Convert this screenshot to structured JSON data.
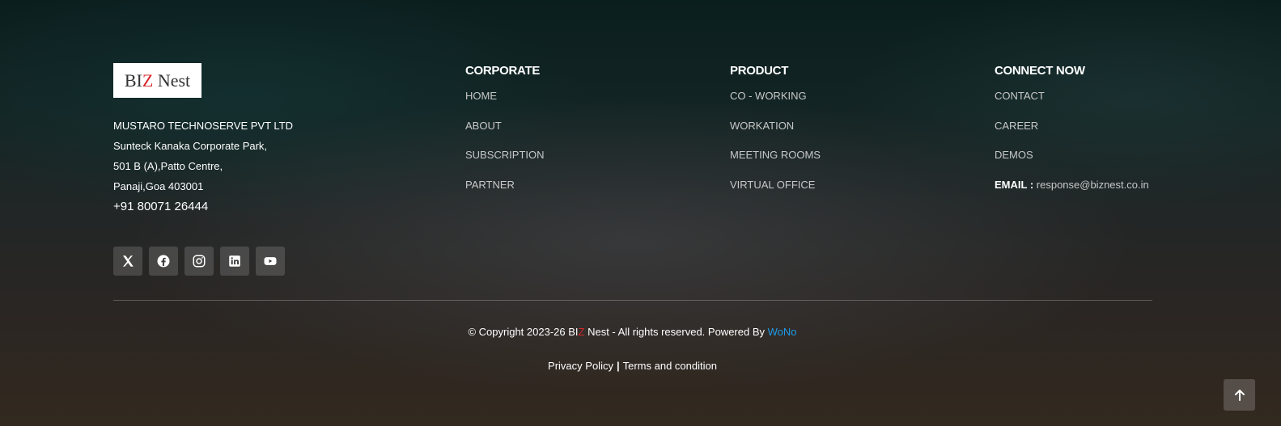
{
  "brand": {
    "logo": {
      "text_before": "BI",
      "text_z": "Z",
      "text_after": " Nest"
    },
    "company": "MUSTARO TECHNOSERVE PVT LTD",
    "address_line1": "Sunteck Kanaka Corporate Park,",
    "address_line2": "501 B (A),Patto Centre,",
    "address_line3": "Panaji,Goa 403001",
    "phone": "+91 80071 26444"
  },
  "social": [
    {
      "name": "x-icon"
    },
    {
      "name": "facebook-icon"
    },
    {
      "name": "instagram-icon"
    },
    {
      "name": "linkedin-icon"
    },
    {
      "name": "youtube-icon"
    }
  ],
  "columns": {
    "corporate": {
      "title": "CORPORATE",
      "links": [
        "HOME",
        "ABOUT",
        "SUBSCRIPTION",
        "PARTNER"
      ]
    },
    "product": {
      "title": "PRODUCT",
      "links": [
        "CO - WORKING",
        "WORKATION",
        "MEETING ROOMS",
        "VIRTUAL OFFICE"
      ]
    },
    "connect": {
      "title": "CONNECT NOW",
      "links": [
        "CONTACT",
        "CAREER",
        "DEMOS"
      ],
      "email_label": "EMAIL :",
      "email": "response@biznest.co.in"
    }
  },
  "copyright": {
    "prefix": "© Copyright 2023-26 BI",
    "z": "Z",
    "suffix": " Nest - All rights reserved. Powered By ",
    "powered_by": "WoNo"
  },
  "legal": {
    "privacy": "Privacy Policy",
    "separator": "|",
    "terms": "Terms and condition"
  },
  "colors": {
    "accent_red": "#d9262b",
    "link_blue": "#1e9be9"
  },
  "scroll_top": {
    "icon": "arrow-up-icon"
  }
}
